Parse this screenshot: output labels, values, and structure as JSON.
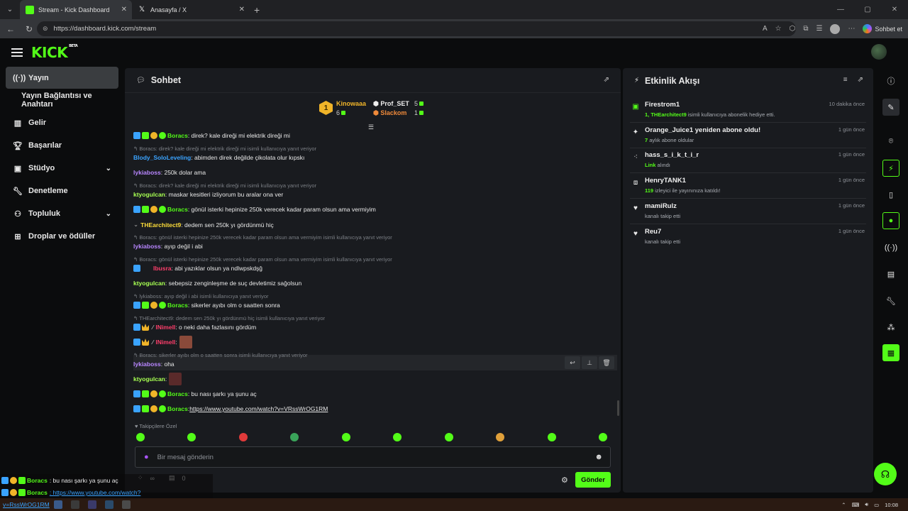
{
  "browser": {
    "tabs": [
      {
        "title": "Stream - Kick Dashboard",
        "active": true
      },
      {
        "title": "Anasayfa / X",
        "active": false
      }
    ],
    "url": "https://dashboard.kick.com/stream",
    "copilot_label": "Sohbet et"
  },
  "brand": {
    "logo": "KICK",
    "beta": "BETA",
    "accent": "#53fc18"
  },
  "sidebar": {
    "items": [
      {
        "label": "Yayın",
        "icon": "broadcast-icon",
        "active": true
      },
      {
        "label": "Yayın Bağlantısı ve Anahtarı",
        "icon": "",
        "sub": true
      },
      {
        "label": "Gelir",
        "icon": "chart-icon"
      },
      {
        "label": "Başarılar",
        "icon": "trophy-icon"
      },
      {
        "label": "Stüdyo",
        "icon": "studio-icon",
        "expandable": true
      },
      {
        "label": "Denetleme",
        "icon": "wrench-icon"
      },
      {
        "label": "Topluluk",
        "icon": "community-icon",
        "expandable": true
      },
      {
        "label": "Droplar ve ödüller",
        "icon": "gift-icon"
      }
    ]
  },
  "chat": {
    "title": "Sohbet",
    "leaderboard": [
      {
        "rank": "1",
        "name": "Kinowaaa",
        "count": "6"
      },
      {
        "name": "Prof_SET",
        "count": "5"
      },
      {
        "name": "Slackom",
        "count": "1"
      }
    ],
    "messages": [
      {
        "user": "Boracs",
        "text": ": direk? kale direği mi elektrik direği mi"
      },
      {
        "reply": "Boracs: direk? kale direği mi elektrik direği mi isimli kullanıcıya yanıt veriyor",
        "user": "Blody_SoloLeveling",
        "text": ": abimden direk değilde çikolata olur kıpskı"
      },
      {
        "user": "lykiaboss",
        "text": ": 250k dolar ama"
      },
      {
        "reply": "Boracs: direk? kale direği mi elektrik direği mi isimli kullanıcıya yanıt veriyor",
        "user": "ktyogulcan",
        "text": ": maskar kesitleri izliyorum bu aralar ona ver"
      },
      {
        "user": "Boracs",
        "text": ": gönül isterki hepinize 250k verecek kadar param olsun ama vermiyim"
      },
      {
        "user": "THEarchitect9",
        "text": ": dedem sen 250k yı gördünmü hiç"
      },
      {
        "reply": "Boracs: gönül isterki hepinize 250k verecek kadar param olsun ama vermiyim isimli kullanıcıya yanıt veriyor",
        "user": "lykiaboss",
        "text": ": ayıp değil i abi"
      },
      {
        "reply": "Boracs: gönül isterki hepinize 250k verecek kadar param olsun ama vermiyim isimli kullanıcıya yanıt veriyor",
        "user": "Ibusra",
        "text": ": abi yazıklar olsun ya ndlwpskdşğ"
      },
      {
        "user": "ktyogulcan",
        "text": ": sebepsiz zenginleşme de suç devletimiz sağolsun"
      },
      {
        "reply": "lykiaboss: ayıp değil i abi isimli kullanıcıya yanıt veriyor",
        "user": "Boracs",
        "text": ": sikerler ayıbı olm o saatten sonra"
      },
      {
        "reply": "THEarchitect9: dedem sen 250k yı gördünmü hiç isimli kullanıcıya yanıt veriyor",
        "user": "lNimell",
        "text": ": o neki daha fazlasını gördüm"
      },
      {
        "user": "lNimell",
        "text": ":"
      },
      {
        "reply": "Boracs: sikerler ayıbı olm o saatten sonra isimli kullanıcıya yanıt veriyor",
        "user": "lykiaboss",
        "text": ": oha"
      },
      {
        "user": "ktyogulcan",
        "text": ":"
      },
      {
        "user": "Boracs",
        "text": ": bu nası şarkı ya şunu aç"
      },
      {
        "user": "Boracs",
        "text": ": ",
        "link": "https://www.youtube.com/watch?v=VRssWrOG1RM"
      }
    ],
    "followers_only_label": "Takipçilere Özel",
    "input_placeholder": "Bir mesaj gönderin",
    "stat_left": "∞",
    "stat_right": "0",
    "send_label": "Gönder"
  },
  "activity": {
    "title": "Etkinlik Akışı",
    "items": [
      {
        "icon": "gift-icon",
        "name": "Firestrom1",
        "desc_user": "1, THEarchitect9",
        "desc": " isimli kullanıcıya abonelik hediye etti.",
        "time": "10 dakika önce"
      },
      {
        "icon": "star-icon",
        "name": "Orange_Juice1 yeniden abone oldu!",
        "desc_user": "7",
        "desc": " aylık abone oldular",
        "time": "1 gün önce"
      },
      {
        "icon": "drop-icon",
        "name": "hass_s_i_k_t_i_r",
        "desc_user": "Link",
        "desc": " alındı",
        "time": "1 gün önce"
      },
      {
        "icon": "raid-icon",
        "name": "HenryTANK1",
        "desc_user": "119",
        "desc": " izleyici ile yayınınıza katıldı!",
        "time": "1 gün önce"
      },
      {
        "icon": "heart-icon",
        "name": "mamiRulz",
        "desc_user": "",
        "desc": "kanalı takip etti",
        "time": "1 gün önce"
      },
      {
        "icon": "heart-icon",
        "name": "Reu7",
        "desc_user": "",
        "desc": "kanalı takip etti",
        "time": "1 gün önce"
      }
    ]
  },
  "overlay": {
    "line1_user": "Boracs",
    "line1_text": ": bu nası şarkı ya şunu aç",
    "line2_user": "Boracs",
    "line2_text": ": https://www.youtube.com/watch?",
    "line3_text": "v=RssWrOG1RM"
  },
  "taskbar": {
    "time": "10:08"
  }
}
